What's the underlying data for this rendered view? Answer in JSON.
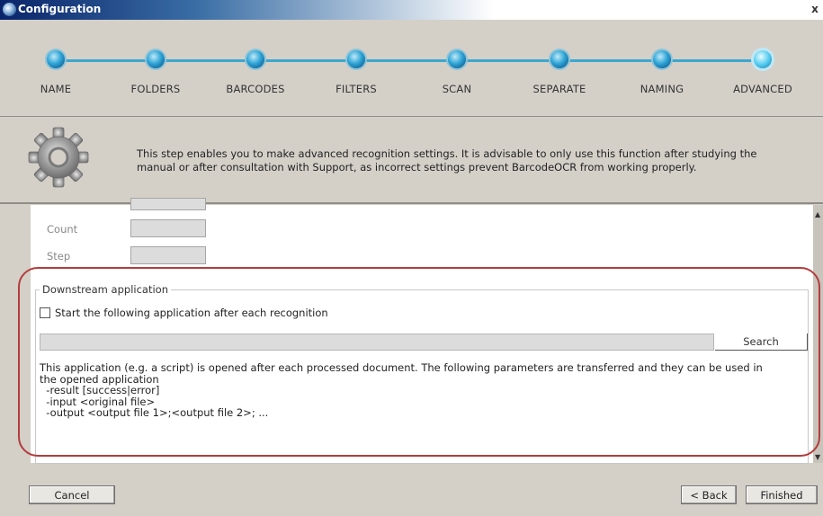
{
  "window": {
    "title": "Configuration",
    "close_glyph": "x"
  },
  "steps": [
    {
      "label": "NAME"
    },
    {
      "label": "FOLDERS"
    },
    {
      "label": "BARCODES"
    },
    {
      "label": "FILTERS"
    },
    {
      "label": "SCAN"
    },
    {
      "label": "SEPARATE"
    },
    {
      "label": "NAMING"
    },
    {
      "label": "ADVANCED",
      "active": true
    }
  ],
  "info": {
    "icon": "gear-icon",
    "line1": "This step enables you to make advanced recognition settings. It is advisable to only use this function after studying the",
    "line2": "manual or after consultation with Support, as incorrect settings prevent BarcodeOCR from working properly."
  },
  "fields": {
    "count_label": "Count",
    "count_value": "",
    "step_label": "Step",
    "step_value": ""
  },
  "downstream": {
    "group_title": "Downstream application",
    "checkbox_label": "Start the following application after each recognition",
    "checkbox_checked": false,
    "path_value": "",
    "search_label": "Search",
    "desc_lines": [
      "This application (e.g. a script) is opened after each processed document. The following parameters are transferred and they can be used in",
      "the opened application",
      "  -result [success|error]",
      "  -input <original file>",
      "  -output <output file 1>;<output file 2>; ..."
    ]
  },
  "buttons": {
    "cancel": "Cancel",
    "back": "< Back",
    "finish": "Finished"
  },
  "colors": {
    "step_line": "#3aa7cf",
    "highlight_outline": "#b33c3c",
    "title_bar": "#0a246a"
  }
}
